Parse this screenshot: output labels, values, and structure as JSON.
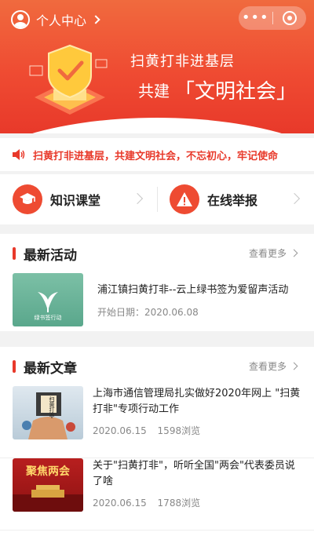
{
  "header": {
    "title": "个人中心",
    "slogan_line1": "扫黄打非进基层",
    "slogan_line2_prefix": "共建",
    "slogan_line2_main": "「文明社会」",
    "capsule_dots": "•••"
  },
  "notice": {
    "text": "扫黄打非进基层，共建文明社会，不忘初心，牢记使命"
  },
  "quick_links": [
    {
      "label": "知识课堂",
      "icon": "graduation-cap-icon"
    },
    {
      "label": "在线举报",
      "icon": "warning-icon"
    }
  ],
  "activities": {
    "title": "最新活动",
    "more": "查看更多",
    "items": [
      {
        "title": "浦江镇扫黄打非--云上绿书签为爱留声活动",
        "date": "开始日期：2020.06.08",
        "thumb_text": "绿书签行动"
      }
    ]
  },
  "articles": {
    "title": "最新文章",
    "more": "查看更多",
    "items": [
      {
        "title": "上海市通信管理局扎实做好2020年网上 \"扫黄打非\"专项行动工作",
        "date": "2020.06.15",
        "views": "1598浏览",
        "thumb_text": "扫黄打非"
      },
      {
        "title": "关于\"扫黄打非\"，听听全国\"两会\"代表委员说了啥",
        "date": "2020.06.15",
        "views": "1788浏览",
        "thumb_text": "聚焦两会"
      }
    ]
  },
  "colors": {
    "accent": "#e8392a",
    "banner_top": "#f06a3e"
  }
}
